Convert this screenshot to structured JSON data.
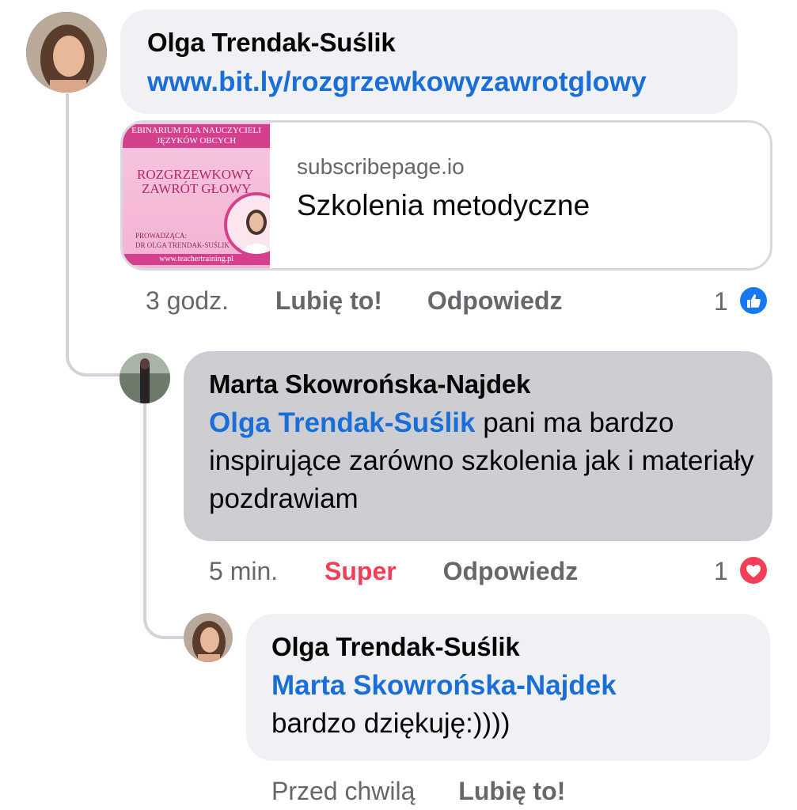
{
  "comment1": {
    "author": "Olga Trendak-Suślik",
    "link": "www.bit.ly/rozgrzewkowyzawrotglowy",
    "preview": {
      "domain": "subscribepage.io",
      "title": "Szkolenia metodyczne",
      "thumb_header": "EBINARIUM DLA NAUCZYCIELI JĘZYKÓW OBCYCH",
      "thumb_title_1": "ROZGRZEWKOWY",
      "thumb_title_2": "ZAWRÓT GŁOWY",
      "thumb_host_1": "PROWADZĄCA:",
      "thumb_host_2": "DR OLGA TRENDAK-SUŚLIK",
      "thumb_footer": "www.teachertraining.pl"
    },
    "time": "3 godz.",
    "like": "Lubię to!",
    "reply": "Odpowiedz",
    "reaction_count": "1",
    "reaction_icon": "like-icon",
    "reaction_color": "#1877f2"
  },
  "comment2": {
    "author": "Marta Skowrońska-Najdek",
    "mention": "Olga Trendak-Suślik",
    "text": " pani ma bardzo inspirujące zarówno szkolenia jak i materiały pozdrawiam",
    "time": "5 min.",
    "reaction_label": "Super",
    "reaction_label_color": "#f33e58",
    "reply": "Odpowiedz",
    "reaction_count": "1",
    "reaction_icon": "love-icon",
    "reaction_color": "#f33e58"
  },
  "comment3": {
    "author": "Olga Trendak-Suślik",
    "mention": "Marta Skowrońska-Najdek",
    "text": "bardzo dziękuję:))))",
    "time": "Przed chwilą",
    "like": "Lubię to!"
  }
}
